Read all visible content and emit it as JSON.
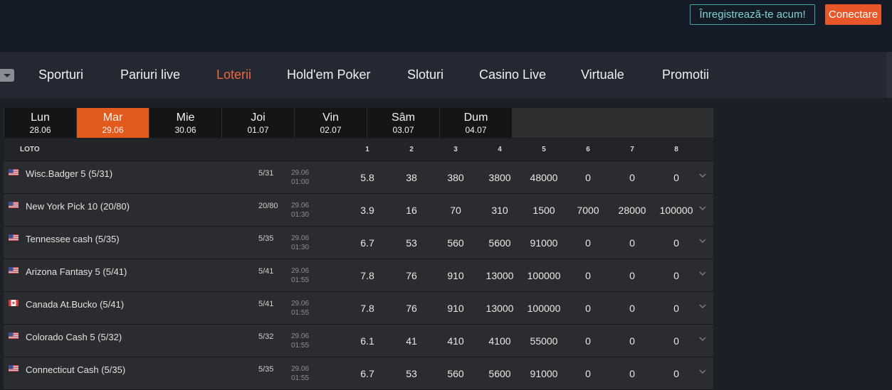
{
  "header": {
    "register_label": "Înregistrează-te acum!",
    "login_label": "Conectare"
  },
  "nav": {
    "items": [
      "Sporturi",
      "Pariuri live",
      "Loterii",
      "Hold'em Poker",
      "Sloturi",
      "Casino Live",
      "Virtuale",
      "Promotii"
    ],
    "active": "Loterii"
  },
  "days": [
    {
      "name": "Lun",
      "date": "28.06",
      "active": false
    },
    {
      "name": "Mar",
      "date": "29.06",
      "active": true
    },
    {
      "name": "Mie",
      "date": "30.06",
      "active": false
    },
    {
      "name": "Joi",
      "date": "01.07",
      "active": false
    },
    {
      "name": "Vin",
      "date": "02.07",
      "active": false
    },
    {
      "name": "Sâm",
      "date": "03.07",
      "active": false
    },
    {
      "name": "Dum",
      "date": "04.07",
      "active": false
    }
  ],
  "table": {
    "section_label": "LOTO",
    "columns": [
      "1",
      "2",
      "3",
      "4",
      "5",
      "6",
      "7",
      "8"
    ],
    "rows": [
      {
        "flag": "us",
        "name": "Wisc.Badger 5 (5/31)",
        "ratio": "5/31",
        "date": "29.06",
        "time": "01:00",
        "odds": [
          "5.8",
          "38",
          "380",
          "3800",
          "48000",
          "0",
          "0",
          "0"
        ]
      },
      {
        "flag": "us",
        "name": "New York Pick 10 (20/80)",
        "ratio": "20/80",
        "date": "29.06",
        "time": "01:30",
        "odds": [
          "3.9",
          "16",
          "70",
          "310",
          "1500",
          "7000",
          "28000",
          "100000"
        ]
      },
      {
        "flag": "us",
        "name": "Tennessee cash (5/35)",
        "ratio": "5/35",
        "date": "29.06",
        "time": "01:30",
        "odds": [
          "6.7",
          "53",
          "560",
          "5600",
          "91000",
          "0",
          "0",
          "0"
        ]
      },
      {
        "flag": "us",
        "name": "Arizona Fantasy 5 (5/41)",
        "ratio": "5/41",
        "date": "29.06",
        "time": "01:55",
        "odds": [
          "7.8",
          "76",
          "910",
          "13000",
          "100000",
          "0",
          "0",
          "0"
        ]
      },
      {
        "flag": "ca",
        "name": "Canada At.Bucko (5/41)",
        "ratio": "5/41",
        "date": "29.06",
        "time": "01:55",
        "odds": [
          "7.8",
          "76",
          "910",
          "13000",
          "100000",
          "0",
          "0",
          "0"
        ]
      },
      {
        "flag": "us",
        "name": "Colorado Cash 5 (5/32)",
        "ratio": "5/32",
        "date": "29.06",
        "time": "01:55",
        "odds": [
          "6.1",
          "41",
          "410",
          "4100",
          "55000",
          "0",
          "0",
          "0"
        ]
      },
      {
        "flag": "us",
        "name": "Connecticut Cash (5/35)",
        "ratio": "5/35",
        "date": "29.06",
        "time": "01:55",
        "odds": [
          "6.7",
          "53",
          "560",
          "5600",
          "91000",
          "0",
          "0",
          "0"
        ]
      }
    ]
  },
  "colors": {
    "accent": "#e8572a",
    "active_tab": "#e25a1c",
    "register_border": "#3aa7a0"
  }
}
